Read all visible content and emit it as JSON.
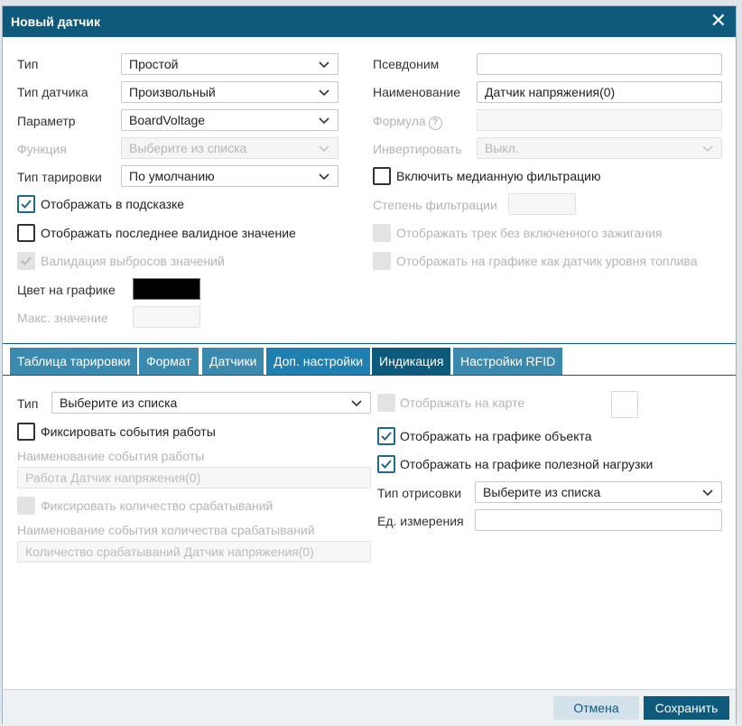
{
  "dialog": {
    "title": "Новый датчик",
    "close_glyph": "✕"
  },
  "left": {
    "type_label": "Тип",
    "type_value": "Простой",
    "sensor_type_label": "Тип датчика",
    "sensor_type_value": "Произвольный",
    "param_label": "Параметр",
    "param_value": "BoardVoltage",
    "func_label": "Функция",
    "func_placeholder": "Выберите из списка",
    "calib_label": "Тип тарировки",
    "calib_value": "По умолчанию",
    "show_hint_label": "Отображать в подсказке",
    "show_last_valid_label": "Отображать последнее валидное значение",
    "validation_label": "Валидация выбросов значений",
    "color_label": "Цвет на графике",
    "color_value": "#000000",
    "max_label": "Макс. значение"
  },
  "right": {
    "alias_label": "Псевдоним",
    "alias_value": "",
    "name_label": "Наименование",
    "name_value": "Датчик напряжения(0)",
    "formula_label": "Формула",
    "formula_help": "?",
    "invert_label": "Инвертировать",
    "invert_value": "Выкл.",
    "median_label": "Включить медианную фильтрацию",
    "filter_degree_label": "Степень фильтрации",
    "track_label": "Отображать трек без включенного зажигания",
    "fuel_label": "Отображать на графике как датчик уровня топлива"
  },
  "tabs": [
    {
      "label": "Таблица тарировки"
    },
    {
      "label": "Формат"
    },
    {
      "label": "Датчики"
    },
    {
      "label": "Доп. настройки"
    },
    {
      "label": "Индикация"
    },
    {
      "label": "Настройки RFID"
    }
  ],
  "indication": {
    "type_label": "Тип",
    "type_placeholder": "Выберите из списка",
    "fix_events_label": "Фиксировать события работы",
    "event_name_label": "Наименование события работы",
    "event_name_value": "Работа Датчик напряжения(0)",
    "fix_count_label": "Фиксировать количество срабатываний",
    "count_name_label": "Наименование события количества срабатываний",
    "count_name_value": "Количество срабатываний Датчик напряжения(0)",
    "show_on_map_label": "Отображать на карте",
    "show_on_object_chart_label": "Отображать на графике объекта",
    "show_on_payload_chart_label": "Отображать на графике полезной нагрузки",
    "draw_type_label": "Тип отрисовки",
    "draw_type_placeholder": "Выберите из списка",
    "unit_label": "Ед. измерения",
    "unit_value": ""
  },
  "footer": {
    "cancel_label": "Отмена",
    "save_label": "Сохранить"
  },
  "colors": {
    "header": "#0e5a7d",
    "tab": "#3a8ab0",
    "tab_active": "#0e5a7d",
    "tab_highlight": "#1e7fb0",
    "checkbox_accent": "#1c6a8c"
  }
}
